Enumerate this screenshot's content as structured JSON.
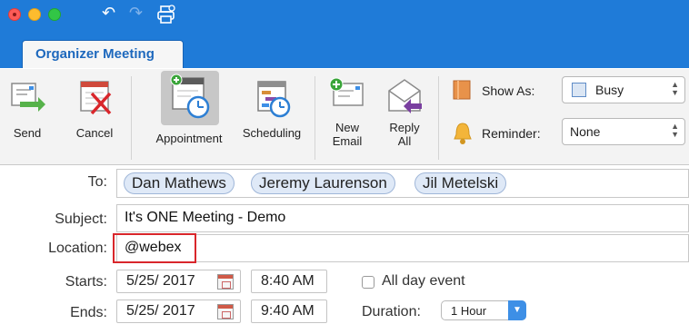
{
  "titlebar": {
    "undo_icon": "undo-icon",
    "redo_icon": "redo-icon",
    "print_icon": "print-icon"
  },
  "tabs": {
    "active_label": "Organizer Meeting"
  },
  "ribbon": {
    "send_label": "Send",
    "cancel_label": "Cancel",
    "appointment_label": "Appointment",
    "scheduling_label": "Scheduling",
    "new_email_line1": "New",
    "new_email_line2": "Email",
    "reply_all_line1": "Reply",
    "reply_all_line2": "All",
    "show_as_label": "Show As:",
    "show_as_value": "Busy",
    "reminder_label": "Reminder:",
    "reminder_value": "None"
  },
  "form": {
    "to_label": "To:",
    "recipients": [
      "Dan Mathews",
      "Jeremy Laurenson",
      "Jil Metelski"
    ],
    "subject_label": "Subject:",
    "subject_value": "It's ONE Meeting - Demo",
    "location_label": "Location:",
    "location_value": "@webex",
    "starts_label": "Starts:",
    "starts_date": "5/25/ 2017",
    "starts_time": "8:40 AM",
    "all_day_label": "All day event",
    "all_day_checked": false,
    "ends_label": "Ends:",
    "ends_date": "5/25/ 2017",
    "ends_time": "9:40 AM",
    "duration_label": "Duration:",
    "duration_value": "1 Hour"
  },
  "colors": {
    "title_bar": "#1f7bd8",
    "tab_text": "#1d68bd",
    "location_highlight": "#d9262b",
    "chip_bg": "#dfe9f7"
  }
}
